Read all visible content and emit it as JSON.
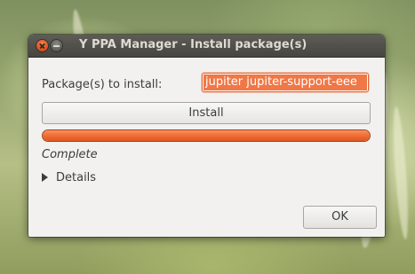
{
  "window": {
    "title": "Y PPA Manager - Install package(s)"
  },
  "form": {
    "packages_label": "Package(s) to install:",
    "packages_value": "jupiter jupiter-support-eee"
  },
  "buttons": {
    "install_label": "Install",
    "ok_label": "OK"
  },
  "progress": {
    "fraction": 1.0,
    "status_text": "Complete"
  },
  "details": {
    "label": "Details",
    "expanded": false
  },
  "colors": {
    "accent": "#f07746",
    "titlebar": "#4f4e49",
    "window_bg": "#f2f1f0"
  },
  "icons": {
    "close": "close-icon",
    "minimize": "minimize-icon",
    "expander": "expander-arrow-icon"
  }
}
